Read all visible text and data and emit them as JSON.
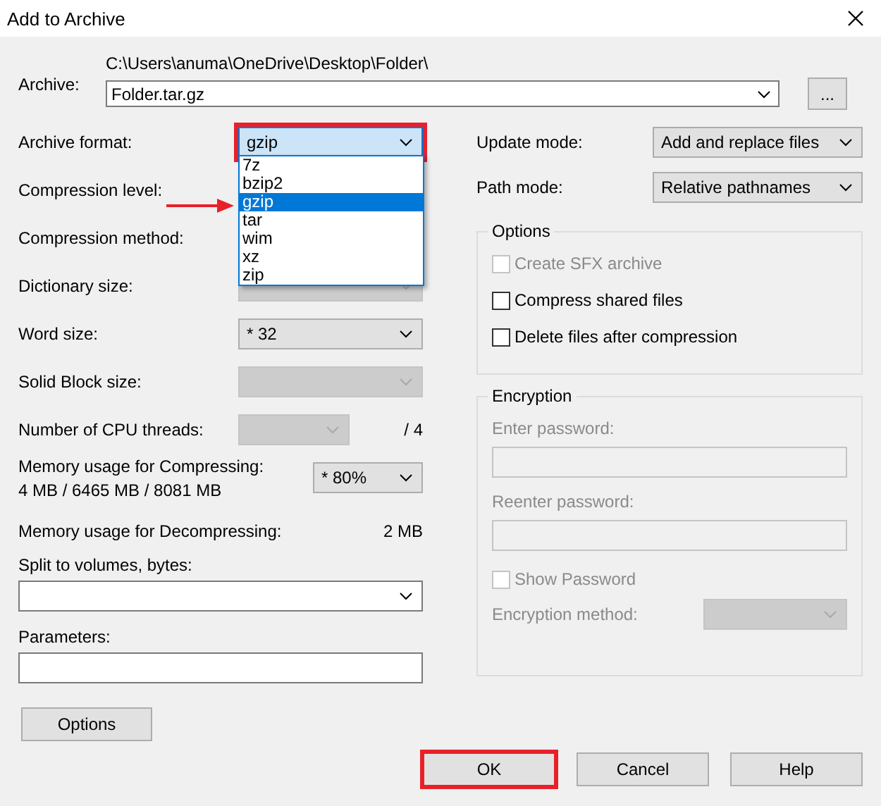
{
  "window": {
    "title": "Add to Archive"
  },
  "archive": {
    "label": "Archive:",
    "path": "C:\\Users\\anuma\\OneDrive\\Desktop\\Folder\\",
    "value": "Folder.tar.gz",
    "browse": "..."
  },
  "settings": [
    {
      "kind": "combo",
      "label": "Archive format:",
      "value": "gzip",
      "disabled": false,
      "highlighted": true,
      "focused": true
    },
    {
      "kind": "label",
      "label": "Compression level:"
    },
    {
      "kind": "label",
      "label": "Compression method:"
    },
    {
      "kind": "combo",
      "label": "Dictionary size:",
      "disabled": true,
      "highlighted": false,
      "focused": false
    },
    {
      "kind": "combo",
      "label": "Word size:",
      "value": "*  32",
      "disabled": false,
      "highlighted": false,
      "focused": false
    },
    {
      "kind": "combo",
      "label": "Solid Block size:",
      "disabled": true,
      "highlighted": false,
      "focused": false
    },
    {
      "kind": "threads",
      "label": "Number of CPU threads:",
      "suffix": "/ 4",
      "disabled": true
    },
    {
      "kind": "memory",
      "label": "Memory usage for Compressing:",
      "detail": "4 MB / 6465 MB / 8081 MB",
      "value": "* 80%"
    },
    {
      "kind": "reading",
      "label": "Memory usage for Decompressing:",
      "value": "2 MB"
    }
  ],
  "split": {
    "label": "Split to volumes, bytes:"
  },
  "parameters": {
    "label": "Parameters:"
  },
  "options_button": "Options",
  "format_list": [
    {
      "label": "7z",
      "selected": false
    },
    {
      "label": "bzip2",
      "selected": false
    },
    {
      "label": "gzip",
      "selected": true
    },
    {
      "label": "tar",
      "selected": false
    },
    {
      "label": "wim",
      "selected": false
    },
    {
      "label": "xz",
      "selected": false
    },
    {
      "label": "zip",
      "selected": false
    }
  ],
  "update_mode": {
    "label": "Update mode:",
    "value": "Add and replace files"
  },
  "path_mode": {
    "label": "Path mode:",
    "value": "Relative pathnames"
  },
  "options": {
    "title": "Options",
    "items": [
      {
        "label": "Create SFX archive",
        "checked": false,
        "disabled": true
      },
      {
        "label": "Compress shared files",
        "checked": false,
        "disabled": false
      },
      {
        "label": "Delete files after compression",
        "checked": false,
        "disabled": false
      }
    ]
  },
  "encryption": {
    "title": "Encryption",
    "enter": "Enter password:",
    "reenter": "Reenter password:",
    "show": {
      "label": "Show Password",
      "checked": false,
      "disabled": true
    },
    "method": "Encryption method:"
  },
  "buttons": [
    {
      "label": "OK",
      "highlighted": true
    },
    {
      "label": "Cancel",
      "highlighted": false
    },
    {
      "label": "Help",
      "highlighted": false
    }
  ]
}
